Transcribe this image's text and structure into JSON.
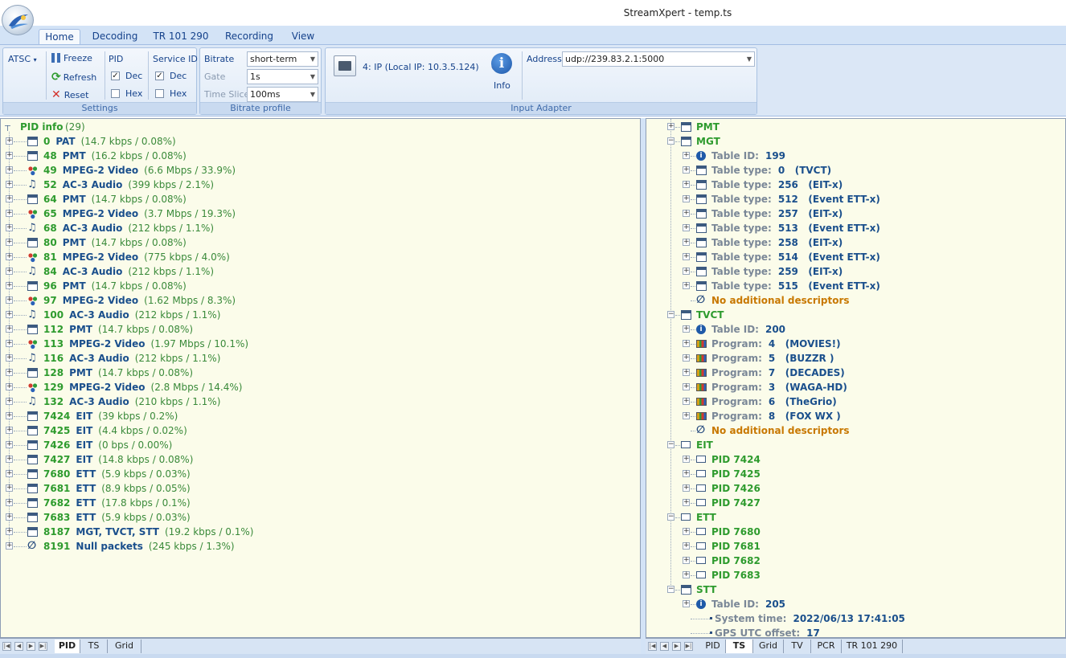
{
  "window": {
    "title": "StreamXpert - temp.ts"
  },
  "ribbon_tabs": [
    {
      "label": "Home",
      "active": true
    },
    {
      "label": "Decoding"
    },
    {
      "label": "TR 101 290"
    },
    {
      "label": "Recording"
    },
    {
      "label": "View"
    }
  ],
  "ribbon": {
    "settings": {
      "caption": "Settings",
      "atsc_label": "ATSC",
      "freeze": "Freeze",
      "refresh": "Refresh",
      "reset": "Reset",
      "pid_label": "PID",
      "service_id_label": "Service ID",
      "dec": "Dec",
      "hex": "Hex",
      "pid_dec_checked": "✓",
      "svc_dec_checked": "✓"
    },
    "bitrate_profile": {
      "caption": "Bitrate profile",
      "bitrate_label": "Bitrate",
      "bitrate_value": "short-term",
      "gate_label": "Gate",
      "gate_value": "1s",
      "timeslice_label": "Time Slice",
      "timeslice_value": "100ms"
    },
    "input_adapter": {
      "caption": "Input Adapter",
      "adapter": "4: IP (Local IP: 10.3.5.124)",
      "info_label": "Info",
      "address_label": "Address",
      "address_value": "udp://239.83.2.1:5000"
    }
  },
  "left_tree": {
    "root": {
      "label": "PID info",
      "count": "(29)"
    },
    "items": [
      {
        "pid": "0",
        "name": "PAT",
        "detail": "(14.7 kbps / 0.08%)",
        "icon": "table"
      },
      {
        "pid": "48",
        "name": "PMT",
        "detail": "(16.2 kbps / 0.08%)",
        "icon": "table"
      },
      {
        "pid": "49",
        "name": "MPEG-2 Video",
        "detail": "(6.6 Mbps / 33.9%)",
        "icon": "video"
      },
      {
        "pid": "52",
        "name": "AC-3 Audio",
        "detail": "(399 kbps / 2.1%)",
        "icon": "audio"
      },
      {
        "pid": "64",
        "name": "PMT",
        "detail": "(14.7 kbps / 0.08%)",
        "icon": "table"
      },
      {
        "pid": "65",
        "name": "MPEG-2 Video",
        "detail": "(3.7 Mbps / 19.3%)",
        "icon": "video"
      },
      {
        "pid": "68",
        "name": "AC-3 Audio",
        "detail": "(212 kbps / 1.1%)",
        "icon": "audio"
      },
      {
        "pid": "80",
        "name": "PMT",
        "detail": "(14.7 kbps / 0.08%)",
        "icon": "table"
      },
      {
        "pid": "81",
        "name": "MPEG-2 Video",
        "detail": "(775 kbps / 4.0%)",
        "icon": "video"
      },
      {
        "pid": "84",
        "name": "AC-3 Audio",
        "detail": "(212 kbps / 1.1%)",
        "icon": "audio"
      },
      {
        "pid": "96",
        "name": "PMT",
        "detail": "(14.7 kbps / 0.08%)",
        "icon": "table"
      },
      {
        "pid": "97",
        "name": "MPEG-2 Video",
        "detail": "(1.62 Mbps / 8.3%)",
        "icon": "video"
      },
      {
        "pid": "100",
        "name": "AC-3 Audio",
        "detail": "(212 kbps / 1.1%)",
        "icon": "audio"
      },
      {
        "pid": "112",
        "name": "PMT",
        "detail": "(14.7 kbps / 0.08%)",
        "icon": "table"
      },
      {
        "pid": "113",
        "name": "MPEG-2 Video",
        "detail": "(1.97 Mbps / 10.1%)",
        "icon": "video"
      },
      {
        "pid": "116",
        "name": "AC-3 Audio",
        "detail": "(212 kbps / 1.1%)",
        "icon": "audio"
      },
      {
        "pid": "128",
        "name": "PMT",
        "detail": "(14.7 kbps / 0.08%)",
        "icon": "table"
      },
      {
        "pid": "129",
        "name": "MPEG-2 Video",
        "detail": "(2.8 Mbps / 14.4%)",
        "icon": "video"
      },
      {
        "pid": "132",
        "name": "AC-3 Audio",
        "detail": "(210 kbps / 1.1%)",
        "icon": "audio"
      },
      {
        "pid": "7424",
        "name": "EIT",
        "detail": "(39 kbps / 0.2%)",
        "icon": "table"
      },
      {
        "pid": "7425",
        "name": "EIT",
        "detail": "(4.4 kbps / 0.02%)",
        "icon": "table"
      },
      {
        "pid": "7426",
        "name": "EIT",
        "detail": "(0 bps / 0.00%)",
        "icon": "table"
      },
      {
        "pid": "7427",
        "name": "EIT",
        "detail": "(14.8 kbps / 0.08%)",
        "icon": "table"
      },
      {
        "pid": "7680",
        "name": "ETT",
        "detail": "(5.9 kbps / 0.03%)",
        "icon": "table"
      },
      {
        "pid": "7681",
        "name": "ETT",
        "detail": "(8.9 kbps / 0.05%)",
        "icon": "table"
      },
      {
        "pid": "7682",
        "name": "ETT",
        "detail": "(17.8 kbps / 0.1%)",
        "icon": "table"
      },
      {
        "pid": "7683",
        "name": "ETT",
        "detail": "(5.9 kbps / 0.03%)",
        "icon": "table"
      },
      {
        "pid": "8187",
        "name": "MGT, TVCT, STT",
        "detail": "(19.2 kbps / 0.1%)",
        "icon": "table"
      },
      {
        "pid": "8191",
        "name": "Null packets",
        "detail": "(245 kbps / 1.3%)",
        "icon": "null"
      }
    ]
  },
  "right_tree": {
    "rows": [
      {
        "depth": 0,
        "icon": "table",
        "label": "PMT",
        "value": "",
        "style": "green",
        "exp": "+"
      },
      {
        "depth": 0,
        "icon": "table",
        "label": "MGT",
        "value": "",
        "style": "green",
        "exp": "-"
      },
      {
        "depth": 1,
        "icon": "info",
        "label": "Table ID:",
        "value": "199",
        "style": "grey",
        "exp": "+"
      },
      {
        "depth": 1,
        "icon": "table",
        "label": "Table type:",
        "value": "0   (TVCT)",
        "style": "grey",
        "exp": "+"
      },
      {
        "depth": 1,
        "icon": "table",
        "label": "Table type:",
        "value": "256   (EIT-x)",
        "style": "grey",
        "exp": "+"
      },
      {
        "depth": 1,
        "icon": "table",
        "label": "Table type:",
        "value": "512   (Event ETT-x)",
        "style": "grey",
        "exp": "+"
      },
      {
        "depth": 1,
        "icon": "table",
        "label": "Table type:",
        "value": "257   (EIT-x)",
        "style": "grey",
        "exp": "+"
      },
      {
        "depth": 1,
        "icon": "table",
        "label": "Table type:",
        "value": "513   (Event ETT-x)",
        "style": "grey",
        "exp": "+"
      },
      {
        "depth": 1,
        "icon": "table",
        "label": "Table type:",
        "value": "258   (EIT-x)",
        "style": "grey",
        "exp": "+"
      },
      {
        "depth": 1,
        "icon": "table",
        "label": "Table type:",
        "value": "514   (Event ETT-x)",
        "style": "grey",
        "exp": "+"
      },
      {
        "depth": 1,
        "icon": "table",
        "label": "Table type:",
        "value": "259   (EIT-x)",
        "style": "grey",
        "exp": "+"
      },
      {
        "depth": 1,
        "icon": "table",
        "label": "Table type:",
        "value": "515   (Event ETT-x)",
        "style": "grey",
        "exp": "+"
      },
      {
        "depth": 1,
        "icon": "null",
        "label": "No additional descriptors",
        "value": "",
        "style": "orange",
        "exp": ""
      },
      {
        "depth": 0,
        "icon": "table",
        "label": "TVCT",
        "value": "",
        "style": "green",
        "exp": "-"
      },
      {
        "depth": 1,
        "icon": "info",
        "label": "Table ID:",
        "value": "200",
        "style": "grey",
        "exp": "+"
      },
      {
        "depth": 1,
        "icon": "prog",
        "label": "Program:",
        "value": "4   (MOVIES!)",
        "style": "grey",
        "exp": "+"
      },
      {
        "depth": 1,
        "icon": "prog",
        "label": "Program:",
        "value": "5   (BUZZR )",
        "style": "grey",
        "exp": "+"
      },
      {
        "depth": 1,
        "icon": "prog",
        "label": "Program:",
        "value": "7   (DECADES)",
        "style": "grey",
        "exp": "+"
      },
      {
        "depth": 1,
        "icon": "prog",
        "label": "Program:",
        "value": "3   (WAGA-HD)",
        "style": "grey",
        "exp": "+"
      },
      {
        "depth": 1,
        "icon": "prog",
        "label": "Program:",
        "value": "6   (TheGrio)",
        "style": "grey",
        "exp": "+"
      },
      {
        "depth": 1,
        "icon": "prog",
        "label": "Program:",
        "value": "8   (FOX WX )",
        "style": "grey",
        "exp": "+"
      },
      {
        "depth": 1,
        "icon": "null",
        "label": "No additional descriptors",
        "value": "",
        "style": "orange",
        "exp": ""
      },
      {
        "depth": 0,
        "icon": "pid",
        "label": "EIT",
        "value": "",
        "style": "green",
        "exp": "-"
      },
      {
        "depth": 1,
        "icon": "pid",
        "label": "PID 7424",
        "value": "",
        "style": "green",
        "exp": "+"
      },
      {
        "depth": 1,
        "icon": "pid",
        "label": "PID 7425",
        "value": "",
        "style": "green",
        "exp": "+"
      },
      {
        "depth": 1,
        "icon": "pid",
        "label": "PID 7426",
        "value": "",
        "style": "green",
        "exp": "+"
      },
      {
        "depth": 1,
        "icon": "pid",
        "label": "PID 7427",
        "value": "",
        "style": "green",
        "exp": "+"
      },
      {
        "depth": 0,
        "icon": "pid",
        "label": "ETT",
        "value": "",
        "style": "green",
        "exp": "-"
      },
      {
        "depth": 1,
        "icon": "pid",
        "label": "PID 7680",
        "value": "",
        "style": "green",
        "exp": "+"
      },
      {
        "depth": 1,
        "icon": "pid",
        "label": "PID 7681",
        "value": "",
        "style": "green",
        "exp": "+"
      },
      {
        "depth": 1,
        "icon": "pid",
        "label": "PID 7682",
        "value": "",
        "style": "green",
        "exp": "+"
      },
      {
        "depth": 1,
        "icon": "pid",
        "label": "PID 7683",
        "value": "",
        "style": "green",
        "exp": "+"
      },
      {
        "depth": 0,
        "icon": "table",
        "label": "STT",
        "value": "",
        "style": "green",
        "exp": "-"
      },
      {
        "depth": 1,
        "icon": "info",
        "label": "Table ID:",
        "value": "205",
        "style": "grey",
        "exp": "+"
      },
      {
        "depth": 1,
        "icon": "none",
        "label": "System time:",
        "value": "2022/06/13 17:41:05",
        "style": "grey",
        "exp": ""
      },
      {
        "depth": 1,
        "icon": "none",
        "label": "GPS UTC offset:",
        "value": "17",
        "style": "grey",
        "exp": ""
      }
    ]
  },
  "left_bottom_tabs": [
    {
      "label": "PID",
      "active": true
    },
    {
      "label": "TS"
    },
    {
      "label": "Grid"
    }
  ],
  "right_bottom_tabs": [
    {
      "label": "PID"
    },
    {
      "label": "TS",
      "active": true
    },
    {
      "label": "Grid"
    },
    {
      "label": "TV"
    },
    {
      "label": "PCR"
    },
    {
      "label": "TR 101 290"
    }
  ]
}
